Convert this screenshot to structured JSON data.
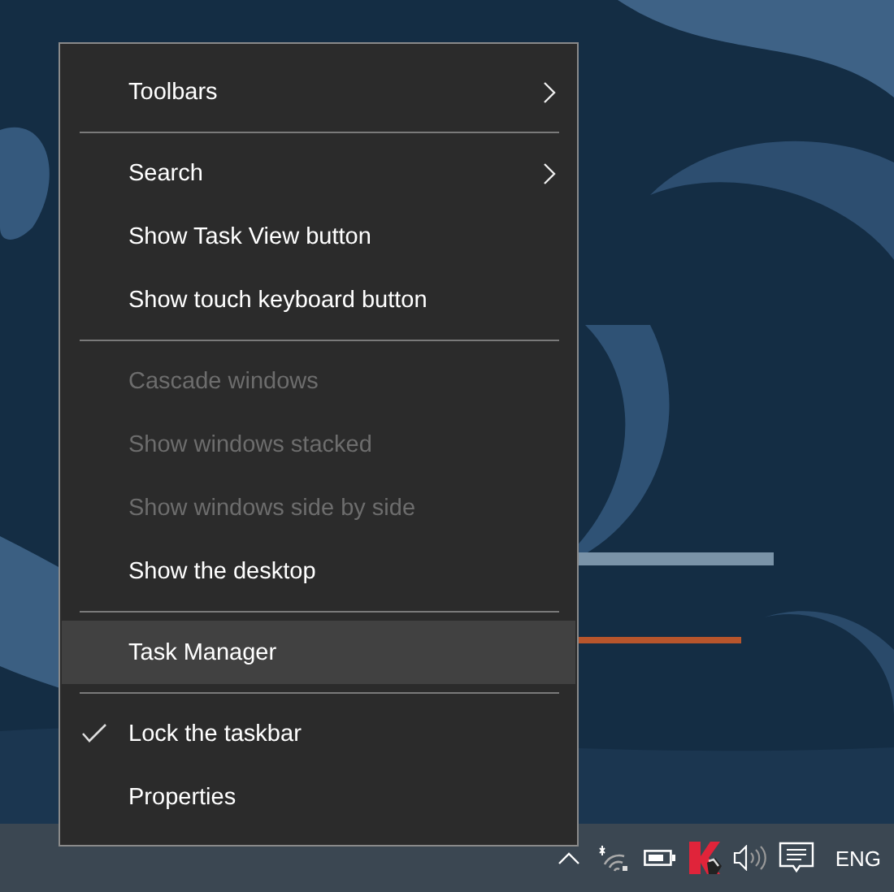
{
  "context_menu": {
    "items": [
      {
        "kind": "item",
        "label": "Toolbars",
        "submenu": true,
        "disabled": false,
        "checked": false,
        "selected": false
      },
      {
        "kind": "separator"
      },
      {
        "kind": "item",
        "label": "Search",
        "submenu": true,
        "disabled": false,
        "checked": false,
        "selected": false
      },
      {
        "kind": "item",
        "label": "Show Task View button",
        "submenu": false,
        "disabled": false,
        "checked": false,
        "selected": false
      },
      {
        "kind": "item",
        "label": "Show touch keyboard button",
        "submenu": false,
        "disabled": false,
        "checked": false,
        "selected": false
      },
      {
        "kind": "separator"
      },
      {
        "kind": "item",
        "label": "Cascade windows",
        "submenu": false,
        "disabled": true,
        "checked": false,
        "selected": false
      },
      {
        "kind": "item",
        "label": "Show windows stacked",
        "submenu": false,
        "disabled": true,
        "checked": false,
        "selected": false
      },
      {
        "kind": "item",
        "label": "Show windows side by side",
        "submenu": false,
        "disabled": true,
        "checked": false,
        "selected": false
      },
      {
        "kind": "item",
        "label": "Show the desktop",
        "submenu": false,
        "disabled": false,
        "checked": false,
        "selected": false
      },
      {
        "kind": "separator"
      },
      {
        "kind": "item",
        "label": "Task Manager",
        "submenu": false,
        "disabled": false,
        "checked": false,
        "selected": true
      },
      {
        "kind": "separator"
      },
      {
        "kind": "item",
        "label": "Lock the taskbar",
        "submenu": false,
        "disabled": false,
        "checked": true,
        "selected": false
      },
      {
        "kind": "item",
        "label": "Properties",
        "submenu": false,
        "disabled": false,
        "checked": false,
        "selected": false
      }
    ]
  },
  "taskbar": {
    "tray": [
      {
        "kind": "caret"
      },
      {
        "kind": "wifi"
      },
      {
        "kind": "battery"
      },
      {
        "kind": "shield"
      },
      {
        "kind": "speaker"
      },
      {
        "kind": "notifications"
      }
    ],
    "language": "ENG"
  }
}
